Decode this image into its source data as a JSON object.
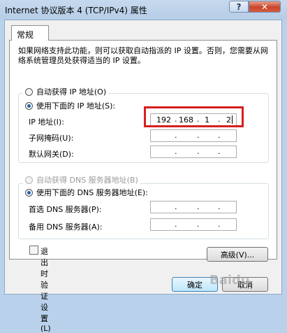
{
  "window": {
    "title": "Internet 协议版本 4 (TCP/IPv4) 属性",
    "help_label": "?",
    "close_label": "✕"
  },
  "tab": {
    "label": "常规"
  },
  "description": "如果网络支持此功能，则可以获取自动指派的 IP 设置。否则，您需要从网络系统管理员处获得适当的 IP 设置。",
  "ip_group": {
    "auto_label": "自动获得 IP 地址(O)",
    "manual_label": "使用下面的 IP 地址(S):",
    "selected": "manual",
    "ip_label": "IP 地址(I):",
    "ip_value": [
      "192",
      "168",
      "1",
      "2"
    ],
    "subnet_label": "子网掩码(U):",
    "gateway_label": "默认网关(D):"
  },
  "dns_group": {
    "auto_label": "自动获得 DNS 服务器地址(B)",
    "manual_label": "使用下面的 DNS 服务器地址(E):",
    "selected": "manual",
    "preferred_label": "首选 DNS 服务器(P):",
    "alternate_label": "备用 DNS 服务器(A):"
  },
  "validate_label": "退出时验证设置(L)",
  "advanced_label": "高级(V)...",
  "ok_label": "确定",
  "cancel_label": "取消",
  "watermark": "Baidu",
  "colors": {
    "highlight": "#d61f1f",
    "close": "#c9452b"
  }
}
